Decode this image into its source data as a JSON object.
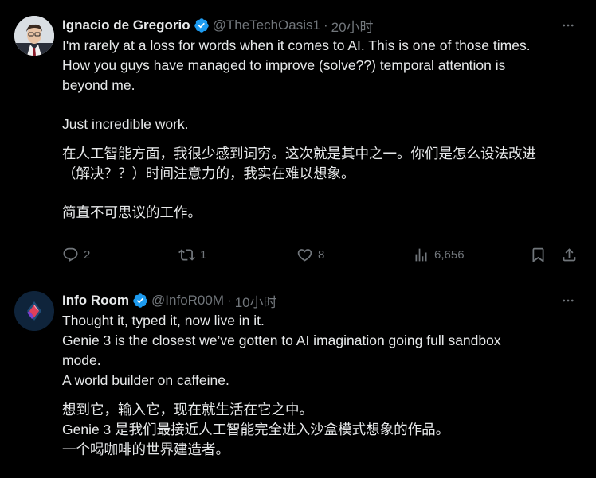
{
  "tweets": [
    {
      "name": "Ignacio de Gregorio",
      "handle": "@TheTechOasis1",
      "separator": "·",
      "time": "20小时",
      "lines_en": [
        "I'm rarely at a loss for words when it comes to AI. This is one of those times.",
        "How you guys have managed to improve (solve??) temporal attention is",
        "beyond me."
      ],
      "line_en_2": "Just incredible work.",
      "lines_zh": [
        "在人工智能方面，我很少感到词穷。这次就是其中之一。你们是怎么设法改进",
        "（解决？？）时间注意力的，我实在难以想象。"
      ],
      "line_zh_2": "简直不可思议的工作。",
      "replies": "2",
      "retweets": "1",
      "likes": "8",
      "views": "6,656"
    },
    {
      "name": "Info Room",
      "handle": "@InfoR00M",
      "separator": "·",
      "time": "10小时",
      "lines_en": [
        "Thought it, typed it, now live in it.",
        "Genie 3 is the closest we’ve gotten to AI imagination going full sandbox",
        "mode.",
        "A world builder on caffeine."
      ],
      "lines_zh": [
        "想到它，输入它，现在就生活在它之中。",
        "Genie 3 是我们最接近人工智能完全进入沙盒模式想象的作品。",
        "一个喝咖啡的世界建造者。"
      ]
    }
  ],
  "colors": {
    "background": "#000000",
    "text": "#e7e9ea",
    "secondary": "#71767b",
    "verified": "#1d9bf0",
    "divider": "#2f3336"
  },
  "icons": [
    "verified-badge-icon",
    "more-icon",
    "reply-icon",
    "retweet-icon",
    "like-icon",
    "views-icon",
    "bookmark-icon",
    "share-icon"
  ]
}
